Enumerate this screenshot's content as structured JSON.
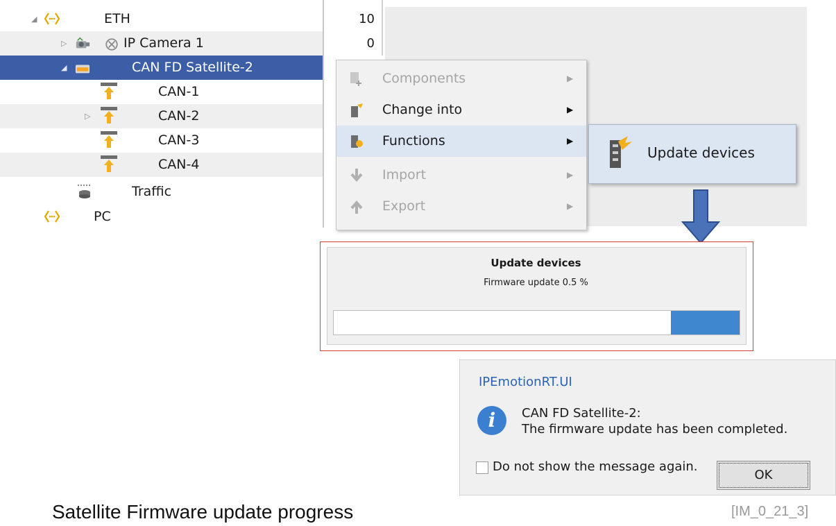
{
  "tree": {
    "rows": [
      {
        "label": "ETH",
        "count": "10"
      },
      {
        "label": "IP Camera 1",
        "count": "0"
      },
      {
        "label": "CAN FD Satellite-2",
        "count": ""
      },
      {
        "label": "CAN-1",
        "count": ""
      },
      {
        "label": "CAN-2",
        "count": ""
      },
      {
        "label": "CAN-3",
        "count": ""
      },
      {
        "label": "CAN-4",
        "count": ""
      },
      {
        "label": "Traffic",
        "count": ""
      },
      {
        "label": "PC",
        "count": ""
      }
    ],
    "selected_row": "CAN FD Satellite-2"
  },
  "context_menu": {
    "items": [
      {
        "label": "Components",
        "enabled": false
      },
      {
        "label": "Change into",
        "enabled": true
      },
      {
        "label": "Functions",
        "enabled": true
      },
      {
        "label": "Import",
        "enabled": false
      },
      {
        "label": "Export",
        "enabled": false
      }
    ],
    "submenu": {
      "label": "Update devices"
    }
  },
  "progress_dialog": {
    "title": "Update devices",
    "status": "Firmware update 0.5 %",
    "progress_fraction": 0.17
  },
  "message_box": {
    "title": "IPEmotionRT.UI",
    "line1": "CAN FD Satellite-2:",
    "line2": "The firmware update has been completed.",
    "checkbox_label": "Do not show the message again.",
    "ok_label": "OK"
  },
  "caption": "Satellite Firmware update progress",
  "reference": "[IM_0_21_3]",
  "colors": {
    "selection": "#3b5ea7",
    "progress_fill": "#3f88cf",
    "highlight_border": "#d93a3a",
    "message_title": "#2a63b3",
    "network_icon": "#e0a800",
    "arrow": "#4a72b8"
  },
  "icons": [
    "network-node-icon",
    "camera-icon",
    "status-icon",
    "satellite-device-icon",
    "can-channel-icon",
    "traffic-icon",
    "info-icon",
    "down-arrow-icon"
  ]
}
